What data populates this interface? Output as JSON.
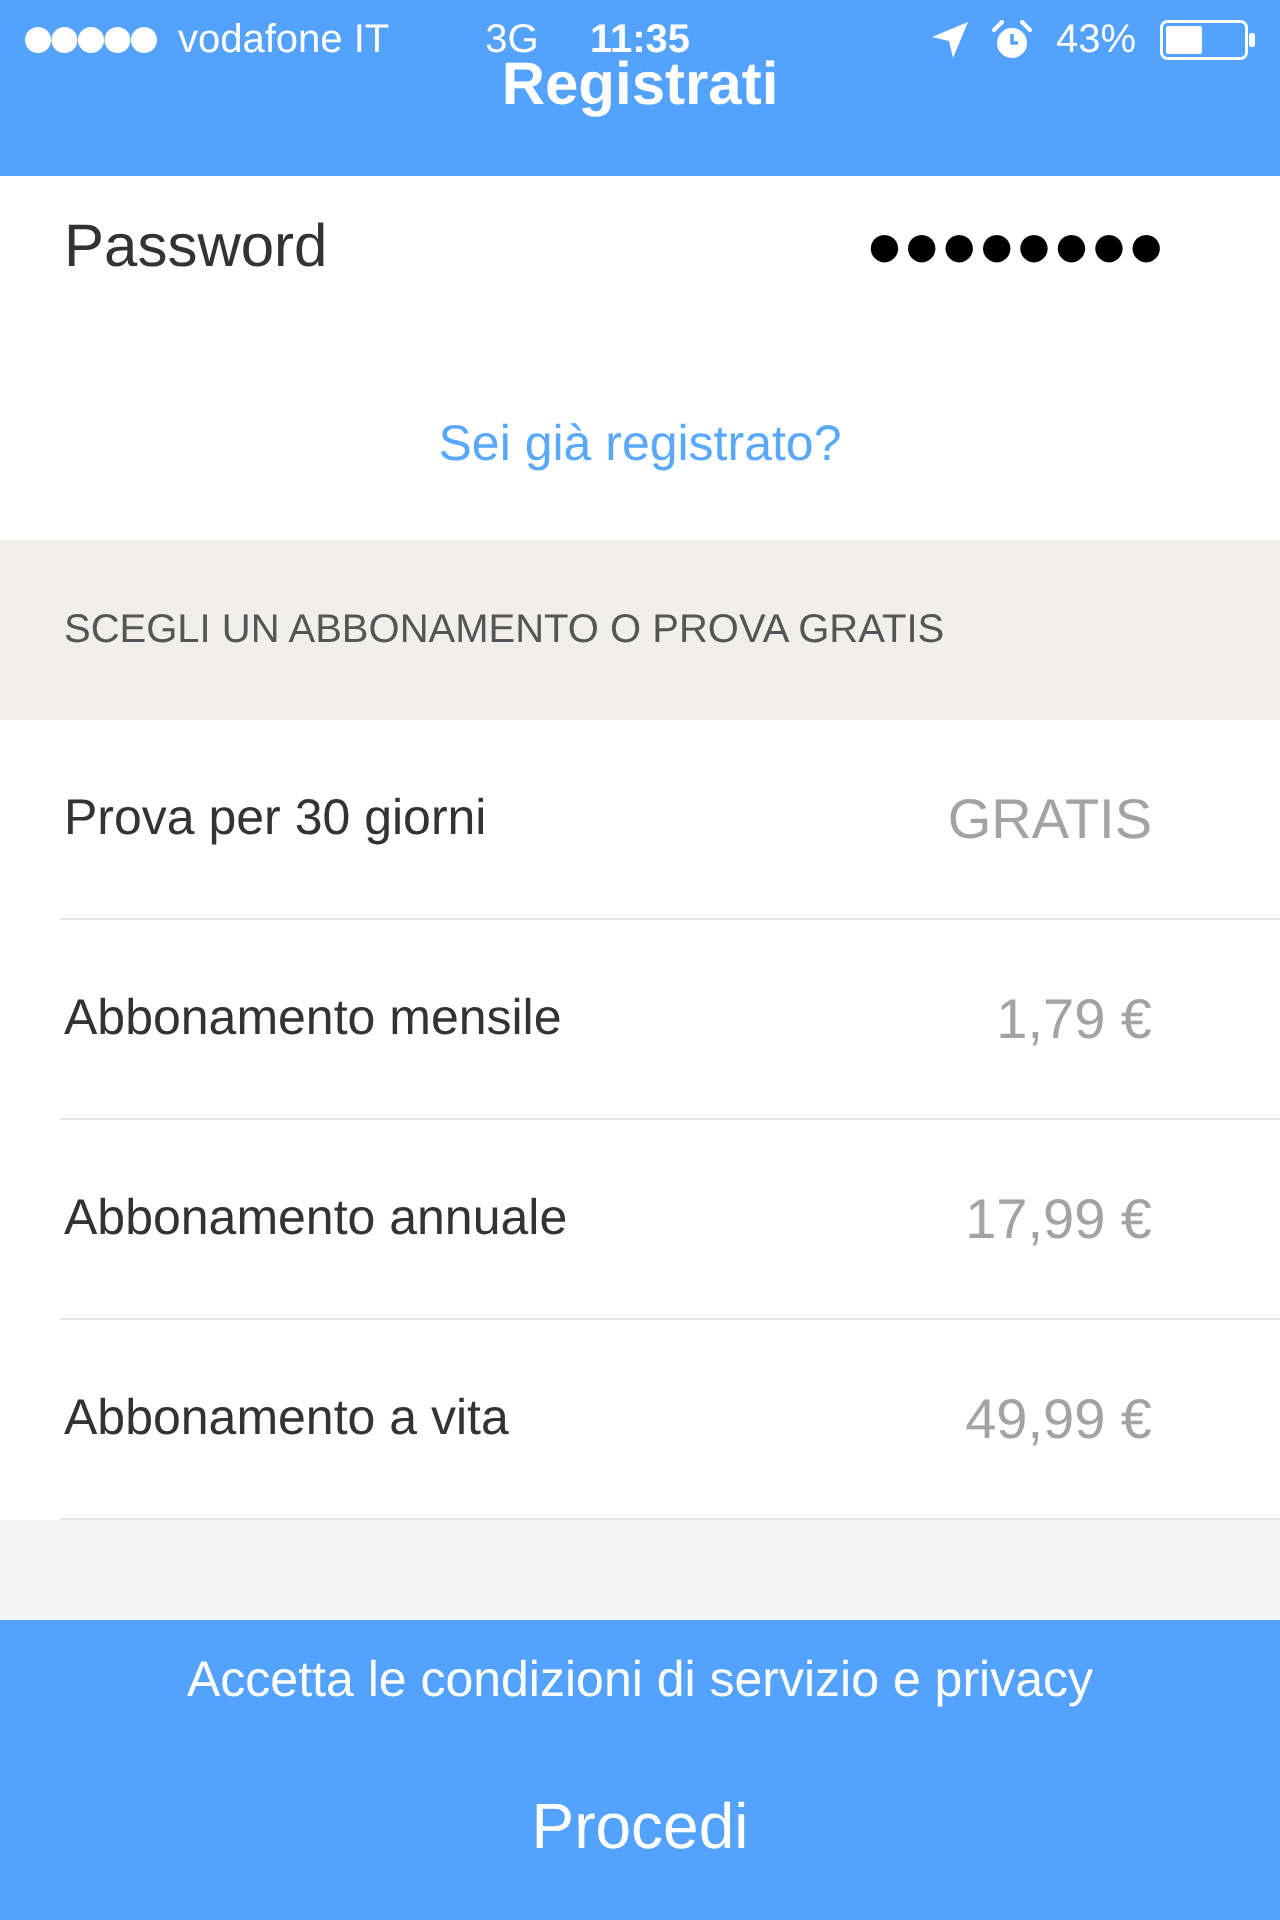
{
  "status_bar": {
    "carrier": "vodafone IT",
    "network": "3G",
    "time": "11:35",
    "battery": "43%"
  },
  "nav_bar": {
    "title": "Registrati"
  },
  "password_field": {
    "label": "Password",
    "value": "●●●●●●●●"
  },
  "login_link": "Sei già registrato?",
  "plans_section": {
    "header": "SCEGLI UN ABBONAMENTO O PROVA GRATIS",
    "plans": [
      {
        "name": "Prova per 30 giorni",
        "price": "GRATIS"
      },
      {
        "name": "Abbonamento mensile",
        "price": "1,79 €"
      },
      {
        "name": "Abbonamento annuale",
        "price": "17,99 €"
      },
      {
        "name": "Abbonamento a vita",
        "price": "49,99 €"
      }
    ]
  },
  "footer": {
    "terms_link": "Accetta le condizioni di servizio e privacy",
    "button": "Procedi"
  }
}
